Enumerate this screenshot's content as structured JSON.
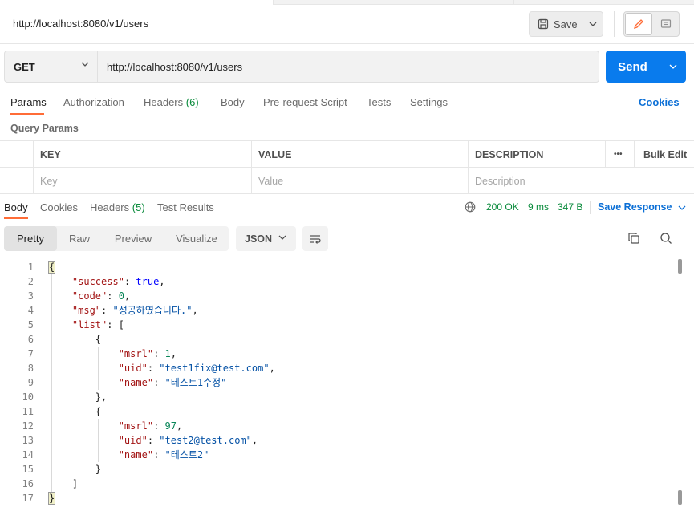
{
  "header": {
    "title": "http://localhost:8080/v1/users",
    "save_label": "Save"
  },
  "request": {
    "method": "GET",
    "url": "http://localhost:8080/v1/users",
    "send_label": "Send"
  },
  "request_tabs": {
    "params": "Params",
    "authorization": "Authorization",
    "headers": "Headers",
    "headers_count": "(6)",
    "body": "Body",
    "prerequest": "Pre-request Script",
    "tests": "Tests",
    "settings": "Settings",
    "cookies": "Cookies"
  },
  "query_params": {
    "label": "Query Params",
    "columns": {
      "key": "KEY",
      "value": "VALUE",
      "description": "DESCRIPTION",
      "more": "•••",
      "bulk_edit": "Bulk Edit"
    },
    "placeholders": {
      "key": "Key",
      "value": "Value",
      "description": "Description"
    }
  },
  "response_tabs": {
    "body": "Body",
    "cookies": "Cookies",
    "headers": "Headers",
    "headers_count": "(5)",
    "test_results": "Test Results"
  },
  "response_status": {
    "status": "200 OK",
    "time": "9 ms",
    "size": "347 B",
    "save_response": "Save Response"
  },
  "view": {
    "pretty": "Pretty",
    "raw": "Raw",
    "preview": "Preview",
    "visualize": "Visualize",
    "format": "JSON"
  },
  "code_lines": [
    "{",
    "    \"success\": true,",
    "    \"code\": 0,",
    "    \"msg\": \"성공하였습니다.\",",
    "    \"list\": [",
    "        {",
    "            \"msrl\": 1,",
    "            \"uid\": \"test1fix@test.com\",",
    "            \"name\": \"테스트1수정\"",
    "        },",
    "        {",
    "            \"msrl\": 97,",
    "            \"uid\": \"test2@test.com\",",
    "            \"name\": \"테스트2\"",
    "        }",
    "    ]",
    "}"
  ],
  "colors": {
    "accent": "#ff6c37",
    "send": "#097bed",
    "link": "#0b6fd6",
    "success": "#0a8b3c"
  },
  "icons": [
    "save-icon",
    "chevron-down-icon",
    "pencil-icon",
    "comment-icon",
    "globe-icon",
    "wrap-lines-icon",
    "copy-icon",
    "search-icon"
  ]
}
